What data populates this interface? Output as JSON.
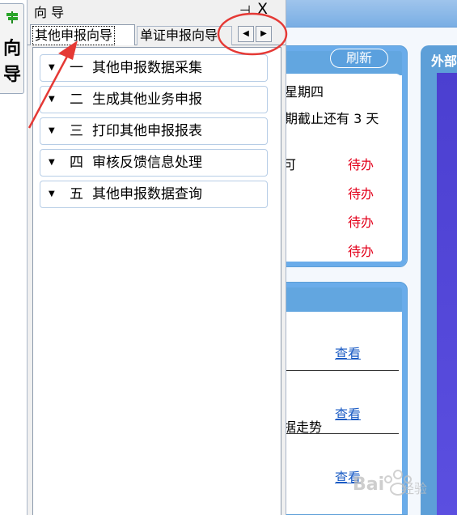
{
  "side_tab": {
    "label": "向导"
  },
  "panel": {
    "title": "向 导",
    "pin_glyph": "⊣",
    "close_glyph": "X",
    "tabs": [
      {
        "label": "其他申报向导",
        "active": true
      },
      {
        "label": "单证申报向导",
        "active": false
      }
    ],
    "scroll_left_glyph": "◀",
    "scroll_right_glyph": "▶",
    "items": [
      {
        "num": "一",
        "label": "其他申报数据采集"
      },
      {
        "num": "二",
        "label": "生成其他业务申报"
      },
      {
        "num": "三",
        "label": "打印其他申报报表"
      },
      {
        "num": "四",
        "label": "审核反馈信息处理"
      },
      {
        "num": "五",
        "label": "其他申报数据查询"
      }
    ]
  },
  "card1": {
    "refresh_label": "刷新",
    "weekday": "星期四",
    "deadline": "期截止还有 3 天",
    "row_label": "可",
    "pending": [
      "待办",
      "待办",
      "待办",
      "待办"
    ]
  },
  "card2": {
    "links": [
      "查看",
      "查看",
      "查看"
    ],
    "trend_text": "据走势"
  },
  "card3": {
    "title": "外部"
  },
  "watermark": {
    "text": "Bai",
    "sub": "经验"
  },
  "colors": {
    "accent_blue": "#62a6e0",
    "pending_red": "#e3001b",
    "link_blue": "#1a5bc4",
    "annotation_red": "#e53935"
  }
}
